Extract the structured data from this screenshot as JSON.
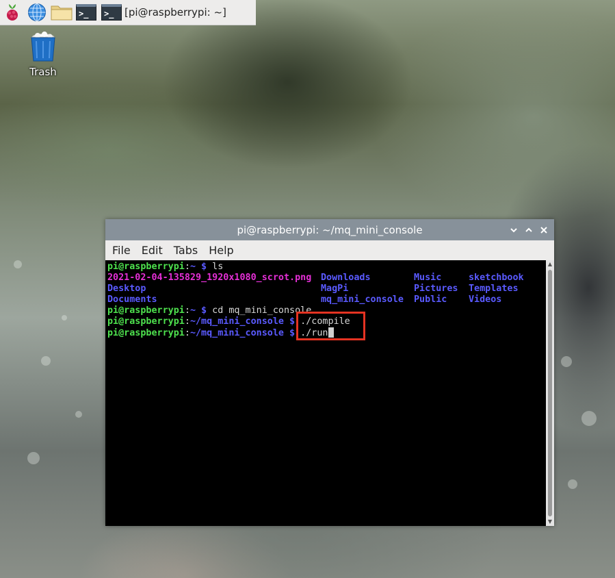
{
  "taskbar": {
    "icons": [
      "raspberry-icon",
      "web-browser-icon",
      "file-manager-icon",
      "terminal-icon"
    ],
    "task_label": "[pi@raspberrypi: ~]"
  },
  "desktop": {
    "trash_label": "Trash"
  },
  "window": {
    "title": "pi@raspberrypi: ~/mq_mini_console",
    "controls": [
      "minimize",
      "maximize",
      "close"
    ],
    "menu": [
      "File",
      "Edit",
      "Tabs",
      "Help"
    ]
  },
  "terminal": {
    "prompt_home_user": "pi@raspberrypi",
    "prompt_home_path": ":~ $",
    "cmd_ls": " ls",
    "ls_row1": {
      "c1": "2021-02-04-135829_1920x1080_scrot.png",
      "c2": "Downloads",
      "c3": "Music",
      "c4": "sketchbook"
    },
    "ls_row2": {
      "c1": "Desktop",
      "c2": "MagPi",
      "c3": "Pictures",
      "c4": "Templates"
    },
    "ls_row3": {
      "c1": "Documents",
      "c2": "mq_mini_console",
      "c3": "Public",
      "c4": "Videos"
    },
    "cmd_cd": " cd mq_mini_console",
    "prompt_user": "pi@raspberrypi",
    "prompt_colon": ":",
    "prompt_dir": "~/mq_mini_console $",
    "cmd_compile": " ./compile",
    "cmd_run": " ./run"
  },
  "colors": {
    "prompt_green": "#4ee24e",
    "dir_blue": "#5a5aff",
    "image_magenta": "#e52fd6",
    "highlight_red": "#e53322",
    "titlebar": "#87919a"
  }
}
